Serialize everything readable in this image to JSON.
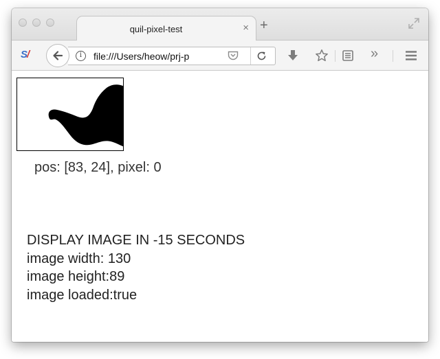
{
  "window": {
    "tab_title": "quil-pixel-test",
    "tab_close": "×",
    "new_tab": "+"
  },
  "toolbar": {
    "url": "file:///Users/heow/prj-pixel-test/index.html",
    "url_visible": "file:///Users/heow/prj-p",
    "info_glyph": "i",
    "overflow_glyph": "»",
    "icons": [
      "back-arrow-icon",
      "info-icon",
      "pocket-icon",
      "reload-icon",
      "download-icon",
      "bookmark-star-icon",
      "reading-list-icon",
      "overflow-chevron-icon",
      "hamburger-menu-icon"
    ]
  },
  "content": {
    "pos_line": "pos: [83, 24], pixel: 0",
    "countdown": "DISPLAY IMAGE IN -15 SECONDS",
    "width_line": "image width: 130",
    "height_line": "image height:89",
    "loaded_line": "image loaded:true"
  },
  "colors": {
    "titlebar": "#dedede",
    "toolbar": "#f4f4f4",
    "shape": "#000000",
    "text": "#222222"
  }
}
